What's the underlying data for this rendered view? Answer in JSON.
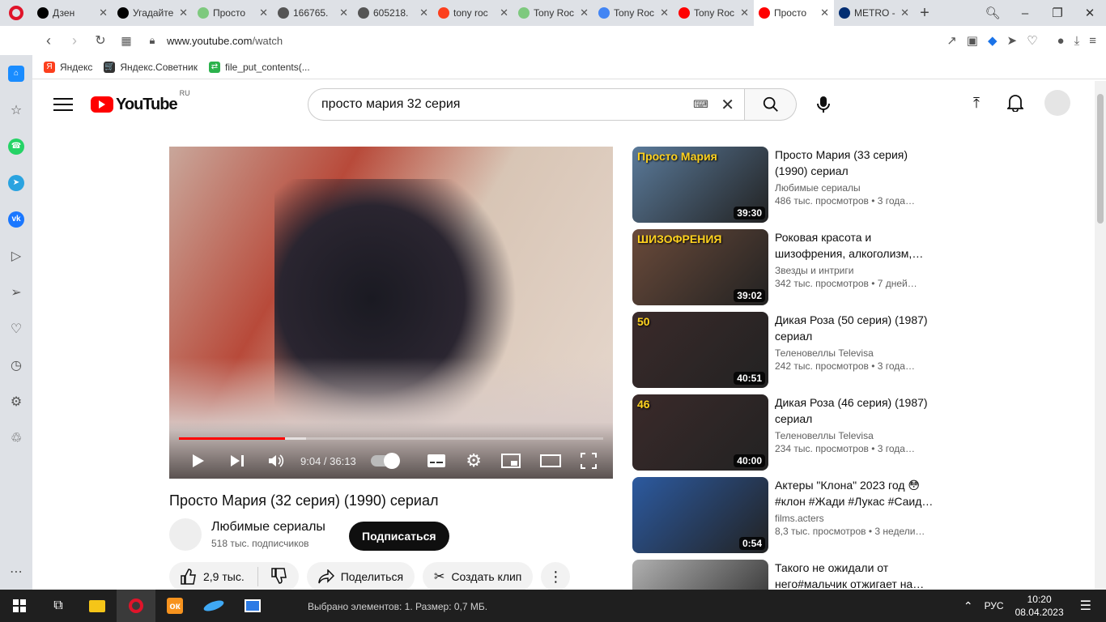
{
  "browser": {
    "tabs": [
      {
        "title": "Дзен",
        "color": "#000000"
      },
      {
        "title": "Угадайте",
        "color": "#000000"
      },
      {
        "title": "Просто",
        "color": "#7ec97e"
      },
      {
        "title": "166765.",
        "color": "#555555"
      },
      {
        "title": "605218.",
        "color": "#555555"
      },
      {
        "title": "tony roc",
        "color": "#fc3f1d"
      },
      {
        "title": "Tony Roc",
        "color": "#7ec97e"
      },
      {
        "title": "Tony Roc",
        "color": "#4285f4"
      },
      {
        "title": "Tony Roc",
        "color": "#ff0000"
      },
      {
        "title": "Просто",
        "color": "#ff0000"
      },
      {
        "title": "METRO -",
        "color": "#002d72"
      }
    ],
    "active_tab_index": 9,
    "url_host": "www.youtube.com",
    "url_path": "/watch",
    "bookmarks": [
      {
        "label": "Яндекс",
        "color": "#fc3f1d",
        "glyph": "Я"
      },
      {
        "label": "Яндекс.Советник",
        "color": "#333333",
        "glyph": "🛒"
      },
      {
        "label": "file_put_contents(...",
        "color": "#2bb24c",
        "glyph": "⇄"
      }
    ]
  },
  "youtube": {
    "region": "RU",
    "search_query": "просто мария 32 серия",
    "video": {
      "title": "Просто Мария (32 серия) (1990) сериал",
      "time": "9:04 / 36:13",
      "progress": 0.25,
      "buffered": 0.3
    },
    "channel": {
      "name": "Любимые сериалы",
      "subscribers": "518 тыс. подписчиков"
    },
    "subscribe_label": "Подписаться",
    "likes": "2,9 тыс.",
    "share_label": "Поделиться",
    "clip_label": "Создать клип",
    "related": [
      {
        "title": "Просто Мария (33 серия) (1990) сериал",
        "channel": "Любимые сериалы",
        "meta": "486 тыс. просмотров  • 3 года…",
        "duration": "39:30",
        "bg": "#5a7a9a",
        "overlay": "Просто Мария"
      },
      {
        "title": "Роковая красота и шизофрения, алкоголизм,…",
        "channel": "Звезды и интриги",
        "meta": "342 тыс. просмотров  • 7 дней…",
        "duration": "39:02",
        "bg": "#6a4a3a",
        "overlay": "ШИЗОФРЕНИЯ"
      },
      {
        "title": "Дикая Роза (50 серия) (1987) сериал",
        "channel": "Теленовеллы Televisa",
        "meta": "242 тыс. просмотров  • 3 года…",
        "duration": "40:51",
        "bg": "#3a2a2a",
        "overlay": "50"
      },
      {
        "title": "Дикая Роза (46 серия) (1987) сериал",
        "channel": "Теленовеллы Televisa",
        "meta": "234 тыс. просмотров  • 3 года…",
        "duration": "40:00",
        "bg": "#3a2a2a",
        "overlay": "46"
      },
      {
        "title": "Актеры \"Клона\" 2023 год 😳 #клон #Жади #Лукас #Саид…",
        "channel": "films.acters",
        "meta": "8,3 тыс. просмотров  • 3 недели…",
        "duration": "0:54",
        "bg": "#2c5aa0",
        "overlay": ""
      },
      {
        "title": "Такого не ожидали от него#мальчик отжигает на…",
        "channel": "",
        "meta": "",
        "duration": "",
        "bg": "#b0b0b0",
        "overlay": ""
      }
    ]
  },
  "taskbar": {
    "status": "Выбрано элементов: 1. Размер: 0,7 МБ.",
    "lang": "РУС",
    "time": "10:20",
    "date": "08.04.2023"
  }
}
